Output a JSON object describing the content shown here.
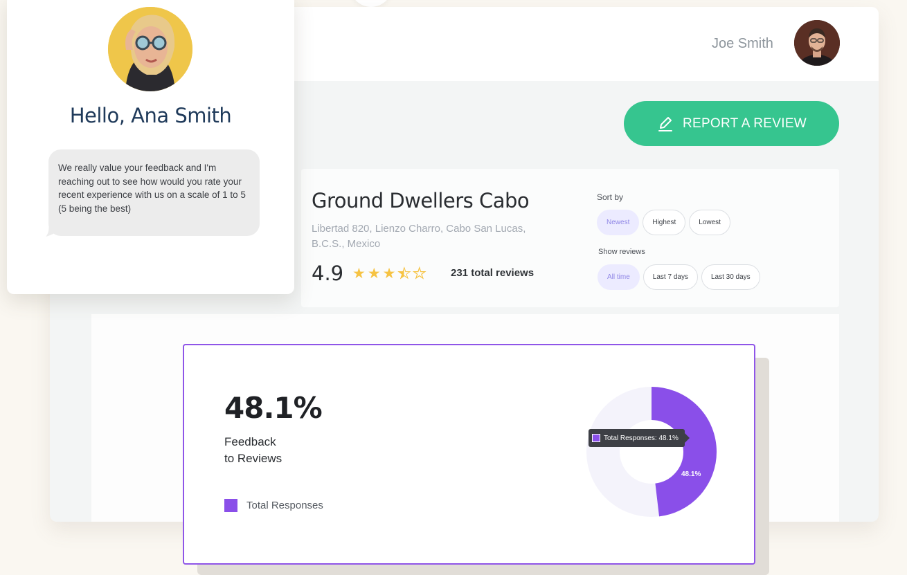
{
  "header": {
    "user_name": "Joe Smith"
  },
  "actions": {
    "report_label": "REPORT A REVIEW"
  },
  "business": {
    "name": "Ground Dwellers Cabo",
    "address": "Libertad 820, Lienzo Charro, Cabo San Lucas, B.C.S., Mexico",
    "rating": "4.9",
    "stars_shown": 3.5,
    "stars_total": 5,
    "total_reviews": "231 total reviews"
  },
  "filters": {
    "sort_label": "Sort by",
    "sort_options": [
      "Newest",
      "Highest",
      "Lowest"
    ],
    "sort_selected": "Newest",
    "show_label": "Show reviews",
    "show_options": [
      "All time",
      "Last 7 days",
      "Last 30 days"
    ],
    "show_selected": "All time"
  },
  "chat": {
    "greeting": "Hello, Ana Smith",
    "message": "We really value your feedback and I'm reaching out to see how would you rate your recent experience with us on a scale of 1 to 5 (5 being the best)"
  },
  "stat": {
    "value": "48.1%",
    "label_line1": "Feedback",
    "label_line2": "to Reviews",
    "legend_label": "Total Responses"
  },
  "chart_data": {
    "type": "pie",
    "categories": [
      "Total Responses"
    ],
    "values": [
      48.1
    ],
    "tooltip": "Total Responses: 48.1%",
    "data_label": "48.1%"
  },
  "colors": {
    "accent_green": "#36c58f",
    "accent_purple": "#8a4fe9",
    "donut_track": "#f4f3fb",
    "star": "#f6c343"
  }
}
